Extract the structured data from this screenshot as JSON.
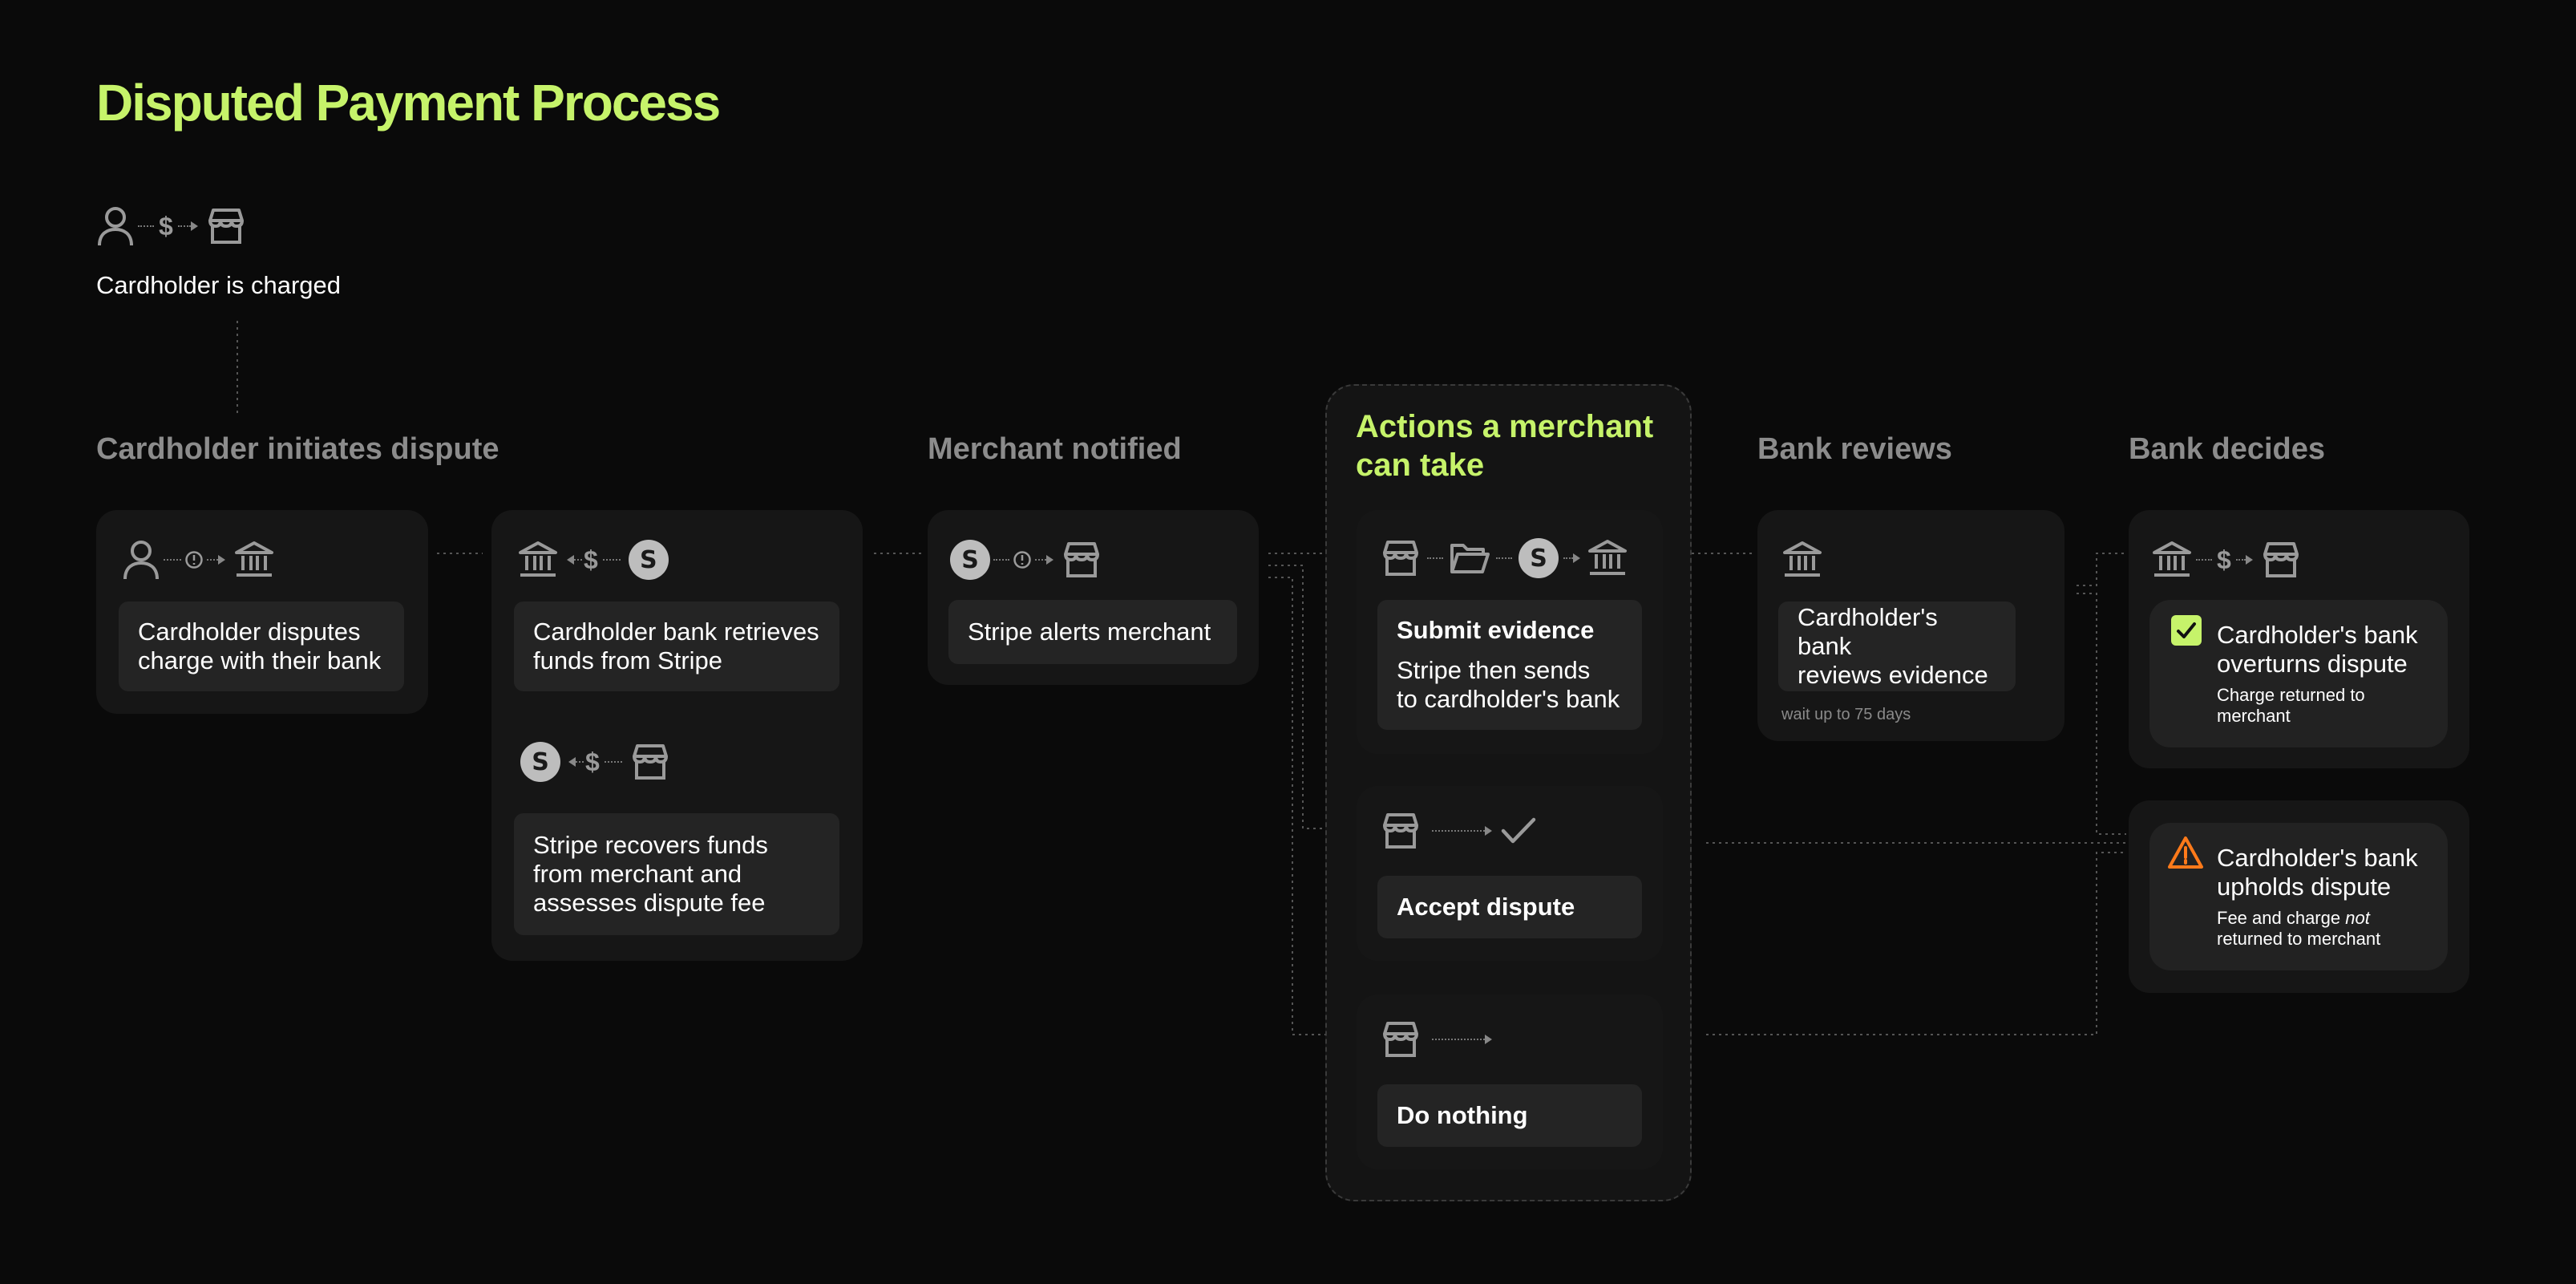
{
  "title": "Disputed Payment Process",
  "colors": {
    "accent": "#c6f36a",
    "background": "#0a0a0a",
    "card": "#161616",
    "inner": "#242424",
    "muted": "#8c8c8c",
    "warning": "#ff7a1a"
  },
  "start": {
    "label": "Cardholder is charged",
    "icons": [
      "user-icon",
      "dollar-icon",
      "store-icon"
    ]
  },
  "stages": {
    "initiate": "Cardholder initiates dispute",
    "notified": "Merchant notified",
    "actions": "Actions a merchant\ncan take",
    "reviews": "Bank reviews",
    "decides": "Bank decides"
  },
  "steps": {
    "disputes": "Cardholder disputes\ncharge with their bank",
    "retrieves": "Cardholder bank retrieves\nfunds from Stripe",
    "recovers": "Stripe recovers funds\nfrom merchant and\nassesses dispute fee",
    "alerts": "Stripe alerts merchant",
    "evidence_title": "Submit evidence",
    "evidence_body": "Stripe then sends\nto cardholder's bank",
    "accept": "Accept dispute",
    "nothing": "Do nothing",
    "review": "Cardholder's bank\nreviews evidence",
    "review_note": "wait up to 75 days",
    "overturn_title": "Cardholder's bank\noverturns dispute",
    "overturn_sub": "Charge returned to\nmerchant",
    "uphold_title": "Cardholder's bank\nupholds dispute",
    "uphold_sub_pre": "Fee and charge ",
    "uphold_sub_em": "not",
    "uphold_sub_post": "\nreturned to merchant"
  },
  "glyphs": {
    "dollar": "$",
    "stripe": "S"
  }
}
